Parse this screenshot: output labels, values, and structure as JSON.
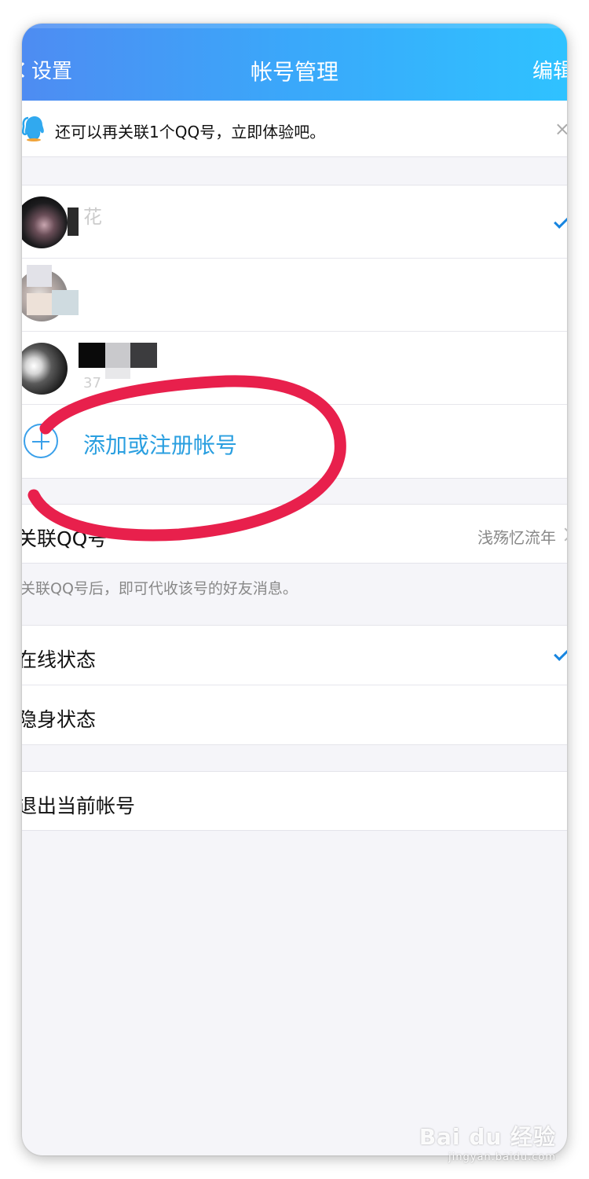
{
  "header": {
    "back_label": "设置",
    "title": "帐号管理",
    "edit_label": "编辑"
  },
  "notice": {
    "text": "还可以再关联1个QQ号，立即体验吧。",
    "close_symbol": "×"
  },
  "accounts": [
    {
      "name": "花",
      "sub": "",
      "selected": true
    },
    {
      "name": "",
      "sub": "",
      "selected": false
    },
    {
      "name": "",
      "sub": "37",
      "selected": false
    }
  ],
  "add_account": {
    "label": "添加或注册帐号"
  },
  "linked_qq": {
    "label": "关联QQ号",
    "value": "浅殇忆流年",
    "hint": "关联QQ号后，即可代收该号的好友消息。"
  },
  "status_options": [
    {
      "label": "在线状态",
      "selected": true
    },
    {
      "label": "隐身状态",
      "selected": false
    }
  ],
  "logout": {
    "label": "退出当前帐号"
  },
  "watermark": {
    "main": "Bai du 经验",
    "sub": "jingyan.baidu.com"
  },
  "colors": {
    "accent": "#2a9fe0",
    "check": "#1785e0",
    "annotation": "#e8204c"
  }
}
